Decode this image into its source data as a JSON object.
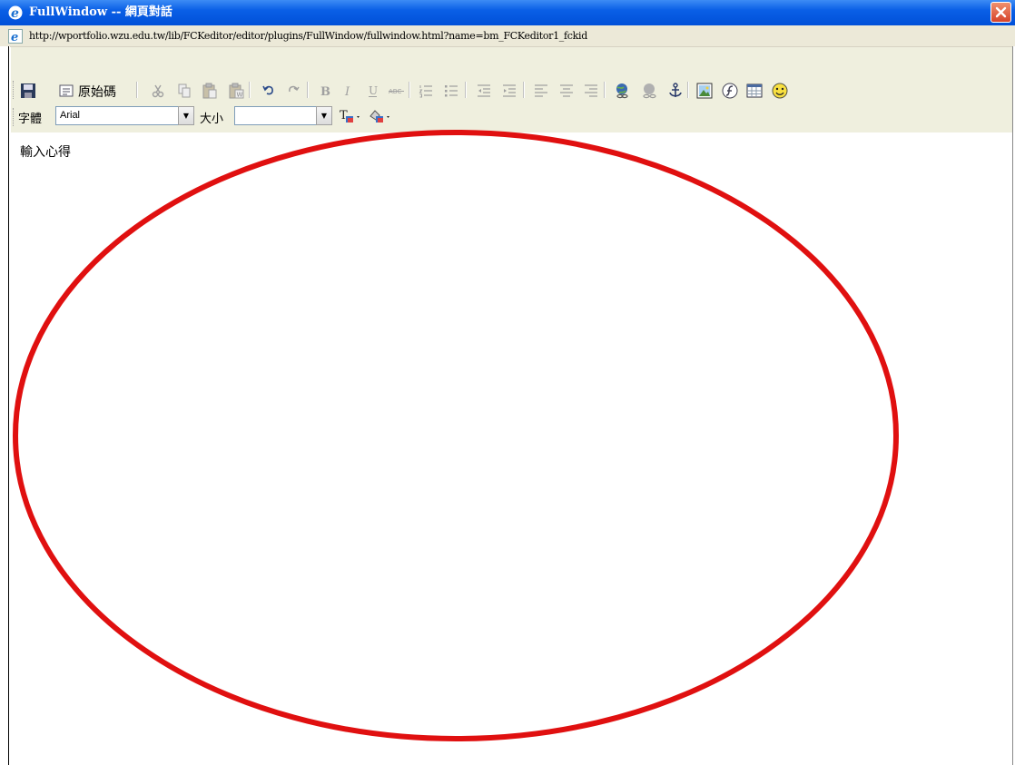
{
  "window": {
    "title": "FullWindow -- 網頁對話",
    "address": "http://wportfolio.wzu.edu.tw/lib/FCKeditor/editor/plugins/FullWindow/fullwindow.html?name=bm_FCKeditor1_fckid",
    "icons": {
      "title": "ie-icon",
      "address": "ie-page-icon",
      "close": "close-icon"
    }
  },
  "toolbar": {
    "source_label": "原始碼",
    "font_label": "字體",
    "font_value": "Arial",
    "size_label": "大小",
    "size_value": "",
    "buttons": [
      "save",
      "source",
      "cut",
      "copy",
      "paste",
      "paste-word",
      "undo",
      "redo",
      "bold",
      "italic",
      "underline",
      "strikethrough",
      "ordered-list",
      "unordered-list",
      "outdent",
      "indent",
      "align-left",
      "align-center",
      "align-right",
      "link",
      "unlink",
      "anchor",
      "image",
      "flash",
      "table",
      "smiley",
      "text-color",
      "bg-color"
    ]
  },
  "editor": {
    "content": "輸入心得"
  },
  "colors": {
    "titlebar": "#0a5fe6",
    "toolbar_bg": "#efefde",
    "annotation": "#e01010"
  }
}
